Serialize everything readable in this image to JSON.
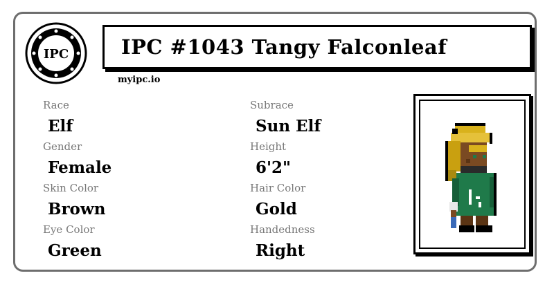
{
  "header": {
    "seal_text": "IPC",
    "title": "IPC #1043 Tangy Falconleaf",
    "site": "myipc.io"
  },
  "fields": [
    {
      "label": "Race",
      "value": "Elf"
    },
    {
      "label": "Subrace",
      "value": "Sun Elf"
    },
    {
      "label": "Gender",
      "value": "Female"
    },
    {
      "label": "Height",
      "value": "6'2\""
    },
    {
      "label": "Skin Color",
      "value": "Brown"
    },
    {
      "label": "Hair Color",
      "value": "Gold"
    },
    {
      "label": "Eye Color",
      "value": "Green"
    },
    {
      "label": "Handedness",
      "value": "Right"
    }
  ],
  "colors": {
    "card_border": "#6e6e6e",
    "label": "#777777",
    "hair": "#d9b21c",
    "skin": "#7a4a22",
    "cloak": "#1f7a4a"
  }
}
